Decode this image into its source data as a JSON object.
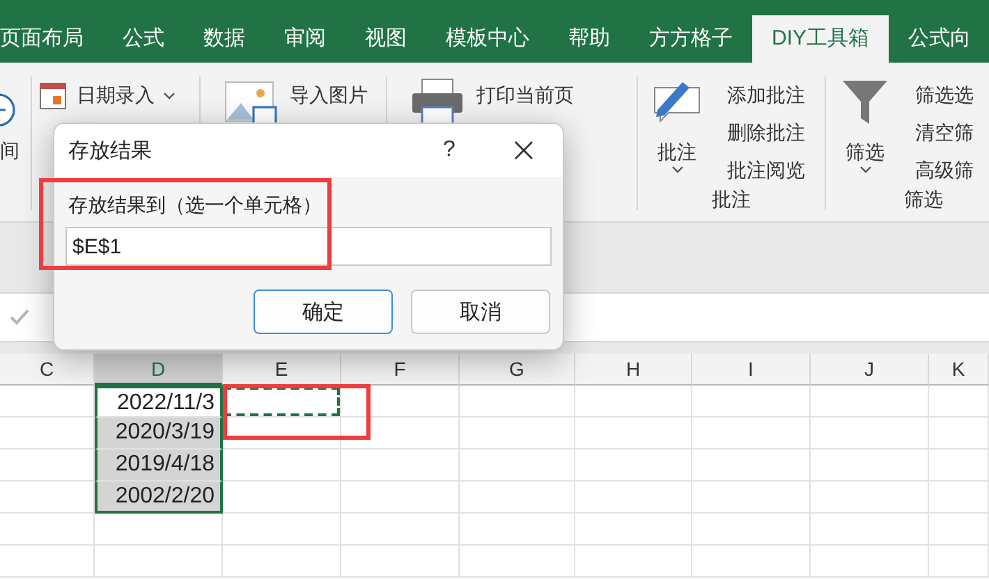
{
  "ribbon_tabs": [
    {
      "label": "页面布局",
      "selected": false
    },
    {
      "label": "公式",
      "selected": false
    },
    {
      "label": "数据",
      "selected": false
    },
    {
      "label": "审阅",
      "selected": false
    },
    {
      "label": "视图",
      "selected": false
    },
    {
      "label": "模板中心",
      "selected": false
    },
    {
      "label": "帮助",
      "selected": false
    },
    {
      "label": "方方格子",
      "selected": false
    },
    {
      "label": "DIY工具箱",
      "selected": true
    },
    {
      "label": "公式向",
      "selected": false
    }
  ],
  "ribbon": {
    "groups": [
      {
        "items": [
          {
            "label": "间",
            "caret": false
          }
        ]
      },
      {
        "items": [
          {
            "label": "日期录入",
            "caret": true
          }
        ]
      },
      {
        "items": [
          {
            "label": "导入图片",
            "caret": false
          }
        ]
      },
      {
        "items": [
          {
            "label": "打印当前页",
            "caret": false
          }
        ]
      },
      {
        "big": {
          "label": "批注",
          "caret": true
        },
        "items": [
          {
            "label": "添加批注",
            "caret": false
          },
          {
            "label": "删除批注",
            "caret": false
          },
          {
            "label": "批注阅览",
            "caret": false
          }
        ],
        "label": "批注"
      },
      {
        "big": {
          "label": "筛选",
          "caret": true
        },
        "items": [
          {
            "label": "筛选选",
            "caret": false
          },
          {
            "label": "清空筛",
            "caret": false
          },
          {
            "label": "高级筛",
            "caret": false
          }
        ],
        "label": "筛选"
      }
    ]
  },
  "sheet": {
    "columns": [
      {
        "label": "C",
        "selected": false
      },
      {
        "label": "D",
        "selected": true
      },
      {
        "label": "E",
        "selected": false
      },
      {
        "label": "F",
        "selected": false
      },
      {
        "label": "G",
        "selected": false
      },
      {
        "label": "H",
        "selected": false
      },
      {
        "label": "I",
        "selected": false
      },
      {
        "label": "J",
        "selected": false
      },
      {
        "label": "K",
        "selected": false
      }
    ],
    "selected_values": [
      {
        "value": "2022/11/3",
        "active": true
      },
      {
        "value": "2020/3/19",
        "active": false
      },
      {
        "value": "2019/4/18",
        "active": false
      },
      {
        "value": "2002/2/20",
        "active": false
      }
    ],
    "copy_marquee": true
  },
  "dialog": {
    "title": "存放结果",
    "help": "?",
    "label": "存放结果到（选一个单元格）",
    "value": "$E$1",
    "buttons": [
      {
        "label": "确定",
        "default": true
      },
      {
        "label": "取消",
        "default": false
      }
    ]
  }
}
